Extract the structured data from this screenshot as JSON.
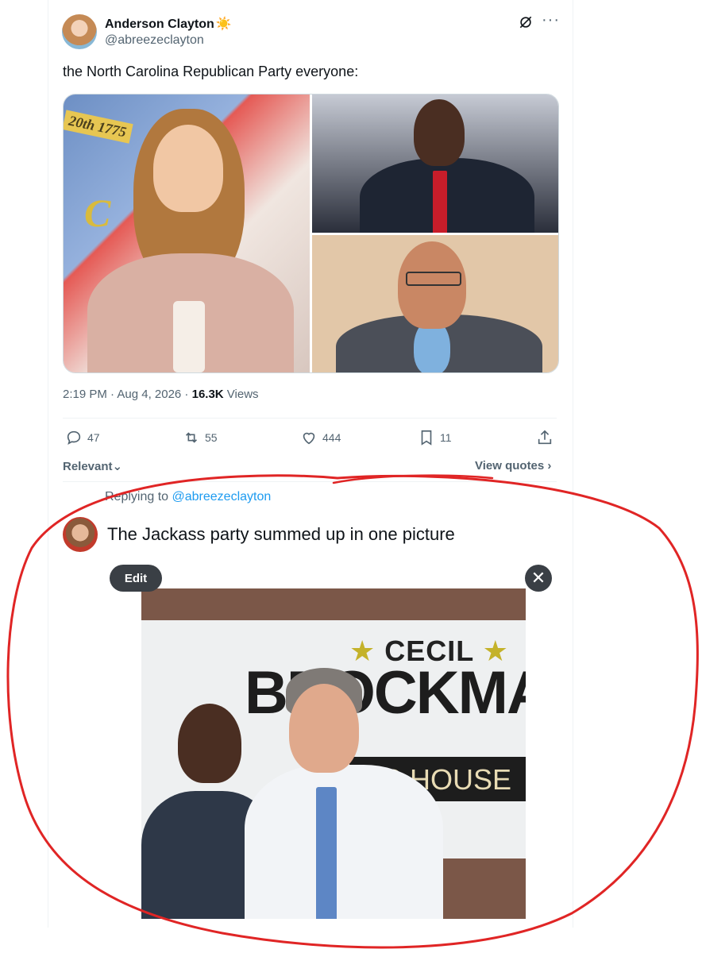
{
  "tweet": {
    "author": {
      "display_name": "Anderson Clayton",
      "badge_emoji": "☀️",
      "handle": "@abreezeclayton"
    },
    "text": "the North Carolina Republican Party everyone:",
    "image_text": {
      "flag_banner": "20th 1775",
      "flag_letter": "C"
    },
    "meta": {
      "time_date": "2:19 PM · Aug 4, 2026 · ",
      "views_count": "16.3K",
      "views_label": " Views"
    },
    "actions": {
      "replies": "47",
      "reposts": "55",
      "likes": "444",
      "bookmarks": "11"
    }
  },
  "filter": {
    "label": "Relevant",
    "view_quotes": "View quotes"
  },
  "reply": {
    "replying_prefix": "Replying to ",
    "replying_handle": "@abreezeclayton",
    "text": "The Jackass party summed up in one picture",
    "edit_label": "Edit",
    "close_glyph": "✕",
    "photo_text": {
      "top": "CECIL",
      "main": "BROCKMA",
      "sub": "NC HOUSE"
    }
  },
  "colors": {
    "accent_link": "#1d9bf0",
    "annotation_red": "#e02525",
    "muted": "#536471"
  }
}
